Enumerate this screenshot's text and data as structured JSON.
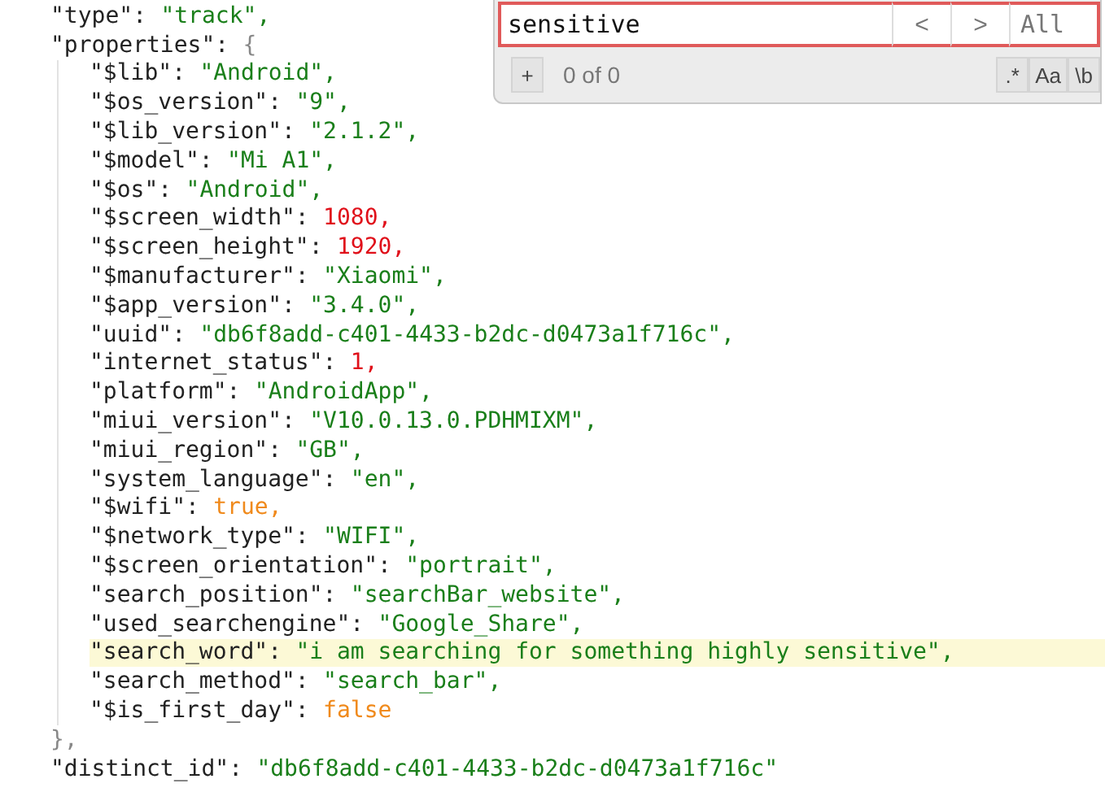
{
  "code": {
    "entries": [
      {
        "key": "\"type\":",
        "value": "\"track\",",
        "kind": "string",
        "highlighted": false
      },
      {
        "key": "\"properties\":",
        "value": "{",
        "kind": "object",
        "highlighted": false,
        "close": "},",
        "children": [
          {
            "key": "\"$lib\":",
            "value": "\"Android\",",
            "kind": "string",
            "highlighted": false
          },
          {
            "key": "\"$os_version\":",
            "value": "\"9\",",
            "kind": "string",
            "highlighted": false
          },
          {
            "key": "\"$lib_version\":",
            "value": "\"2.1.2\",",
            "kind": "string",
            "highlighted": false
          },
          {
            "key": "\"$model\":",
            "value": "\"Mi A1\",",
            "kind": "string",
            "highlighted": false
          },
          {
            "key": "\"$os\":",
            "value": "\"Android\",",
            "kind": "string",
            "highlighted": false
          },
          {
            "key": "\"$screen_width\":",
            "value": "1080,",
            "kind": "number",
            "highlighted": false
          },
          {
            "key": "\"$screen_height\":",
            "value": "1920,",
            "kind": "number",
            "highlighted": false
          },
          {
            "key": "\"$manufacturer\":",
            "value": "\"Xiaomi\",",
            "kind": "string",
            "highlighted": false
          },
          {
            "key": "\"$app_version\":",
            "value": "\"3.4.0\",",
            "kind": "string",
            "highlighted": false
          },
          {
            "key": "\"uuid\":",
            "value": "\"db6f8add-c401-4433-b2dc-d0473a1f716c\",",
            "kind": "string",
            "highlighted": false
          },
          {
            "key": "\"internet_status\":",
            "value": "1,",
            "kind": "number",
            "highlighted": false
          },
          {
            "key": "\"platform\":",
            "value": "\"AndroidApp\",",
            "kind": "string",
            "highlighted": false
          },
          {
            "key": "\"miui_version\":",
            "value": "\"V10.0.13.0.PDHMIXM\",",
            "kind": "string",
            "highlighted": false
          },
          {
            "key": "\"miui_region\":",
            "value": "\"GB\",",
            "kind": "string",
            "highlighted": false
          },
          {
            "key": "\"system_language\":",
            "value": "\"en\",",
            "kind": "string",
            "highlighted": false
          },
          {
            "key": "\"$wifi\":",
            "value": "true,",
            "kind": "boolean",
            "highlighted": false
          },
          {
            "key": "\"$network_type\":",
            "value": "\"WIFI\",",
            "kind": "string",
            "highlighted": false
          },
          {
            "key": "\"$screen_orientation\":",
            "value": "\"portrait\",",
            "kind": "string",
            "highlighted": false
          },
          {
            "key": "\"search_position\":",
            "value": "\"searchBar_website\",",
            "kind": "string",
            "highlighted": false
          },
          {
            "key": "\"used_searchengine\":",
            "value": "\"Google_Share\",",
            "kind": "string",
            "highlighted": false
          },
          {
            "key": "\"search_word\":",
            "value": "\"i am searching for something highly sensitive\",",
            "kind": "string",
            "highlighted": true
          },
          {
            "key": "\"search_method\":",
            "value": "\"search_bar\",",
            "kind": "string",
            "highlighted": false
          },
          {
            "key": "\"$is_first_day\":",
            "value": "false",
            "kind": "boolean",
            "highlighted": false
          }
        ]
      },
      {
        "key": "\"distinct_id\":",
        "value": "\"db6f8add-c401-4433-b2dc-d0473a1f716c\"",
        "kind": "string",
        "highlighted": false
      }
    ]
  },
  "find": {
    "query": "sensitive",
    "prev": "<",
    "next": ">",
    "all": "All",
    "add": "+",
    "count": "0 of 0",
    "options": [
      ".*",
      "Aa",
      "\\b"
    ]
  }
}
